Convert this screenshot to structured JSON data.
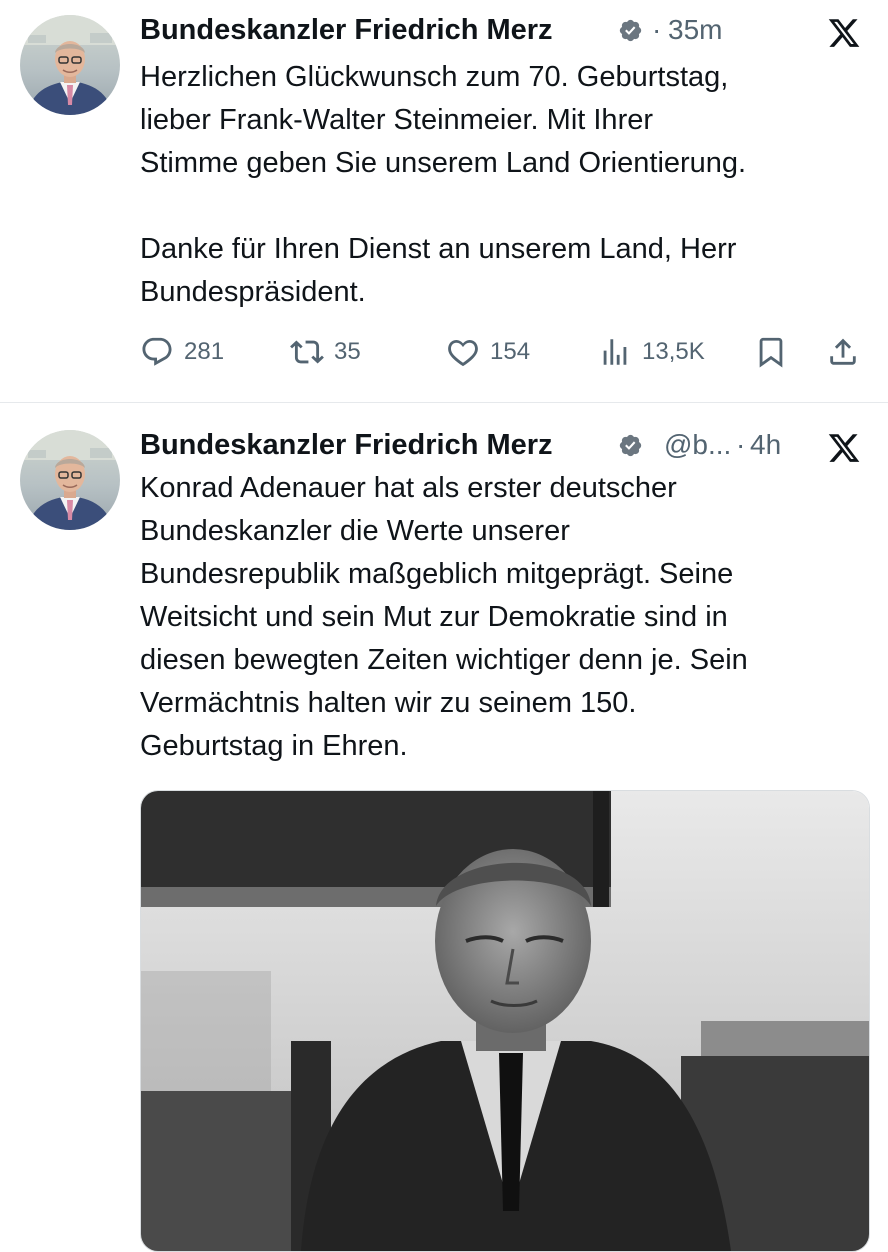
{
  "tweets": [
    {
      "author": "Bundeskanzler Friedrich Merz",
      "handle": "",
      "separator": "·",
      "time": "35m",
      "text": "Herzlichen Glückwunsch zum 70. Geburtstag,\nlieber Frank-Walter Steinmeier. Mit Ihrer\nStimme geben Sie unserem Land Orientierung.\n\nDanke für Ihren Dienst an unserem Land, Herr\nBundespräsident.",
      "replies": "281",
      "reposts": "35",
      "likes": "154",
      "views": "13,5K"
    },
    {
      "author": "Bundeskanzler Friedrich Merz",
      "handle": "@b...",
      "separator": "·",
      "time": "4h",
      "text": "Konrad Adenauer hat als erster deutscher\nBundeskanzler die Werte unserer\nBundesrepublik maßgeblich mitgeprägt. Seine\nWeitsicht und sein Mut zur Demokratie sind in\ndiesen bewegten Zeiten wichtiger denn je. Sein\nVermächtnis halten wir zu seinem 150.\nGeburtstag in Ehren."
    }
  ],
  "icons": {
    "verified": "verified-badge-icon",
    "brand": "x-logo-icon",
    "reply": "reply-icon",
    "repost": "repost-icon",
    "like": "like-icon",
    "views": "views-icon",
    "bookmark": "bookmark-icon",
    "share": "share-icon"
  },
  "colors": {
    "text": "#0f1419",
    "secondary": "#536471",
    "divider": "#e6e9ec",
    "verified_badge": "#6b7680"
  }
}
